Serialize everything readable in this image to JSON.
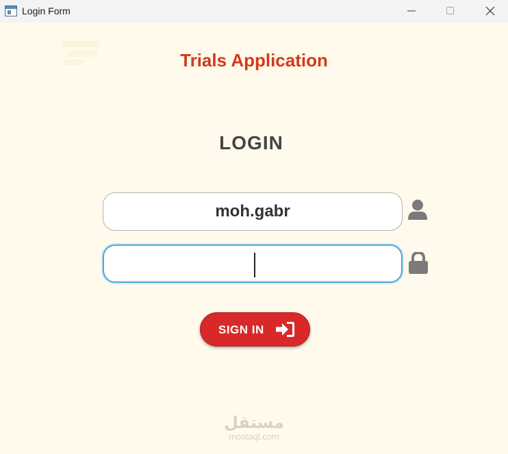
{
  "window": {
    "title": "Login Form",
    "icon": "app-window-icon",
    "controls": [
      "minimize-icon",
      "maximize-icon",
      "close-icon"
    ]
  },
  "app_title": "Trials Application",
  "login_heading": "LOGIN",
  "username": {
    "value": "moh.gabr",
    "icon": "user-icon"
  },
  "password": {
    "value": "",
    "icon": "lock-icon"
  },
  "signin": {
    "label": "SIGN IN",
    "icon": "sign-in-arrow-icon"
  },
  "watermark": {
    "arabic": "مستقل",
    "latin": "mostaql.com"
  },
  "colors": {
    "background": "#fffaeb",
    "title": "#d23a1a",
    "heading": "#444444",
    "button": "#d9282a",
    "focus_border": "#4aa8da",
    "icon": "#7a7a7a"
  }
}
